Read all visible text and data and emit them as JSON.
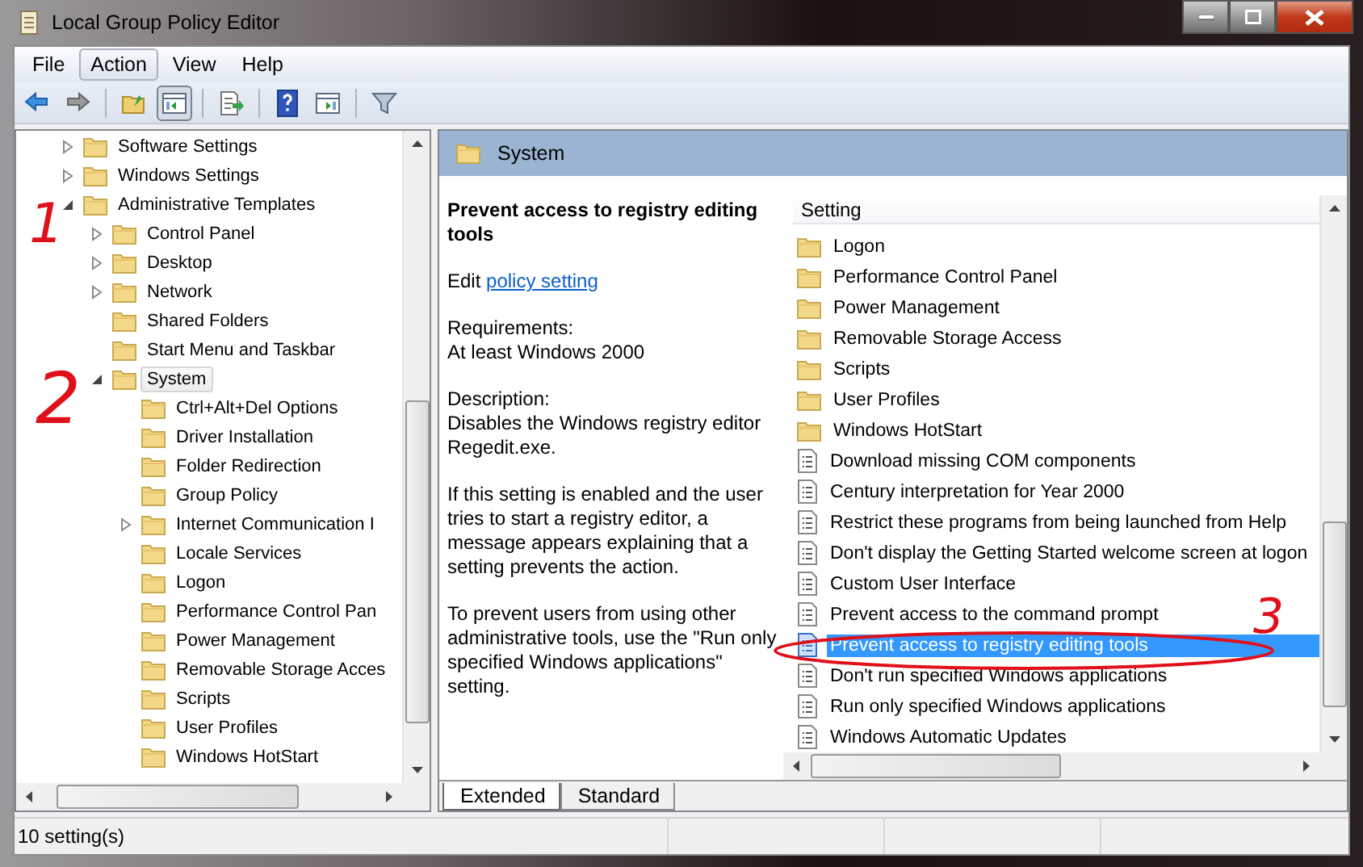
{
  "window": {
    "title": "Local Group Policy Editor"
  },
  "menu": [
    {
      "label": "File",
      "selected": false
    },
    {
      "label": "Action",
      "selected": true
    },
    {
      "label": "View",
      "selected": false
    },
    {
      "label": "Help",
      "selected": false
    }
  ],
  "toolbar": [
    {
      "kind": "back",
      "pressed": false
    },
    {
      "kind": "forward",
      "pressed": false
    },
    {
      "kind": "sep"
    },
    {
      "kind": "up",
      "pressed": false
    },
    {
      "kind": "tree",
      "pressed": true
    },
    {
      "kind": "sep"
    },
    {
      "kind": "export",
      "pressed": false
    },
    {
      "kind": "sep"
    },
    {
      "kind": "help",
      "pressed": false
    },
    {
      "kind": "pane",
      "pressed": false
    },
    {
      "kind": "sep"
    },
    {
      "kind": "filter",
      "pressed": false
    }
  ],
  "tree": [
    {
      "label": "Software Settings",
      "expandable": true,
      "expanded": false,
      "selected": false
    },
    {
      "label": "Windows Settings",
      "expandable": true,
      "expanded": false,
      "selected": false
    },
    {
      "label": "Administrative Templates",
      "expandable": true,
      "expanded": true,
      "selected": false,
      "children": [
        {
          "label": "Control Panel",
          "expandable": true,
          "expanded": false,
          "selected": false
        },
        {
          "label": "Desktop",
          "expandable": true,
          "expanded": false,
          "selected": false
        },
        {
          "label": "Network",
          "expandable": true,
          "expanded": false,
          "selected": false
        },
        {
          "label": "Shared Folders",
          "expandable": false,
          "selected": false
        },
        {
          "label": "Start Menu and Taskbar",
          "expandable": false,
          "selected": false
        },
        {
          "label": "System",
          "expandable": true,
          "expanded": true,
          "selected": true,
          "children": [
            {
              "label": "Ctrl+Alt+Del Options",
              "expandable": false,
              "selected": false
            },
            {
              "label": "Driver Installation",
              "expandable": false,
              "selected": false
            },
            {
              "label": "Folder Redirection",
              "expandable": false,
              "selected": false
            },
            {
              "label": "Group Policy",
              "expandable": false,
              "selected": false
            },
            {
              "label": "Internet Communication I",
              "expandable": true,
              "expanded": false,
              "selected": false
            },
            {
              "label": "Locale Services",
              "expandable": false,
              "selected": false
            },
            {
              "label": "Logon",
              "expandable": false,
              "selected": false
            },
            {
              "label": "Performance Control Pan",
              "expandable": false,
              "selected": false
            },
            {
              "label": "Power Management",
              "expandable": false,
              "selected": false
            },
            {
              "label": "Removable Storage Acces",
              "expandable": false,
              "selected": false
            },
            {
              "label": "Scripts",
              "expandable": false,
              "selected": false
            },
            {
              "label": "User Profiles",
              "expandable": false,
              "selected": false
            },
            {
              "label": "Windows HotStart",
              "expandable": false,
              "selected": false
            }
          ]
        }
      ]
    }
  ],
  "header": {
    "title": "System"
  },
  "description": {
    "title": "Prevent access to registry editing tools",
    "edit_prefix": "Edit",
    "link": "policy setting",
    "paragraphs": [
      "Requirements:\nAt least Windows 2000",
      "Description:\nDisables the Windows registry editor Regedit.exe.",
      "If this setting is enabled and the user tries to start a registry editor, a message appears explaining that a setting prevents the action.",
      "To prevent users from using other administrative tools, use the \"Run only specified Windows applications\" setting."
    ]
  },
  "list": {
    "column": "Setting",
    "rows": [
      {
        "label": "Logon",
        "kind": "folder",
        "selected": false
      },
      {
        "label": "Performance Control Panel",
        "kind": "folder",
        "selected": false
      },
      {
        "label": "Power Management",
        "kind": "folder",
        "selected": false
      },
      {
        "label": "Removable Storage Access",
        "kind": "folder",
        "selected": false
      },
      {
        "label": "Scripts",
        "kind": "folder",
        "selected": false
      },
      {
        "label": "User Profiles",
        "kind": "folder",
        "selected": false
      },
      {
        "label": "Windows HotStart",
        "kind": "folder",
        "selected": false
      },
      {
        "label": "Download missing COM components",
        "kind": "setting",
        "selected": false
      },
      {
        "label": "Century interpretation for Year 2000",
        "kind": "setting",
        "selected": false
      },
      {
        "label": "Restrict these programs from being launched from Help",
        "kind": "setting",
        "selected": false
      },
      {
        "label": "Don't display the Getting Started welcome screen at logon",
        "kind": "setting",
        "selected": false
      },
      {
        "label": "Custom User Interface",
        "kind": "setting",
        "selected": false
      },
      {
        "label": "Prevent access to the command prompt",
        "kind": "setting",
        "selected": false
      },
      {
        "label": "Prevent access to registry editing tools",
        "kind": "setting",
        "selected": true
      },
      {
        "label": "Don't run specified Windows applications",
        "kind": "setting",
        "selected": false
      },
      {
        "label": "Run only specified Windows applications",
        "kind": "setting",
        "selected": false
      },
      {
        "label": "Windows Automatic Updates",
        "kind": "setting",
        "selected": false
      }
    ]
  },
  "tabs": [
    {
      "label": "Extended",
      "selected": true
    },
    {
      "label": "Standard",
      "selected": false
    }
  ],
  "status_bar": {
    "text": "10 setting(s)"
  },
  "annotations": [
    {
      "label": "1"
    },
    {
      "label": "2"
    },
    {
      "label": "3"
    }
  ]
}
